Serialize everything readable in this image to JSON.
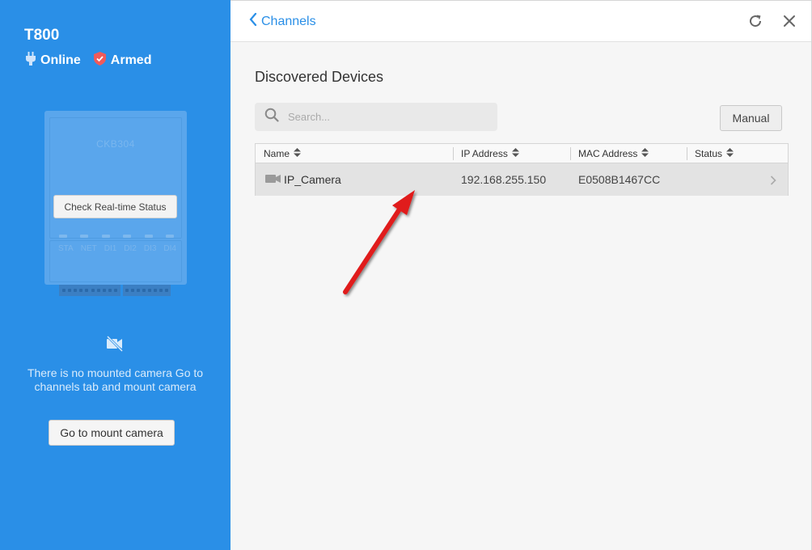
{
  "device": {
    "name": "T800",
    "online_label": "Online",
    "armed_label": "Armed",
    "model": "CKB304",
    "check_status_label": "Check Real-time Status",
    "led_labels": [
      "STA",
      "NET",
      "DI1",
      "DI2",
      "DI3",
      "DI4"
    ],
    "no_camera_text": "There is no mounted camera Go to channels tab and mount camera",
    "mount_camera_label": "Go to mount camera"
  },
  "header": {
    "back_label": "Channels"
  },
  "main": {
    "section_title": "Discovered Devices",
    "search_placeholder": "Search...",
    "manual_label": "Manual",
    "columns": [
      "Name",
      "IP Address",
      "MAC Address",
      "Status"
    ],
    "rows": [
      {
        "name": "IP_Camera",
        "ip": "192.168.255.150",
        "mac": "E0508B1467CC",
        "status": ""
      }
    ]
  },
  "colors": {
    "panel_blue": "#2a8fe7",
    "accent": "#2a8fe7",
    "armed_red": "#f05a5a",
    "arrow_red": "#e01b1b"
  },
  "icons": [
    "plug-icon",
    "shield-icon",
    "camera-off-icon",
    "chevron-left-icon",
    "refresh-icon",
    "close-icon",
    "search-icon",
    "sort-icon",
    "camera-icon",
    "chevron-right-icon"
  ]
}
